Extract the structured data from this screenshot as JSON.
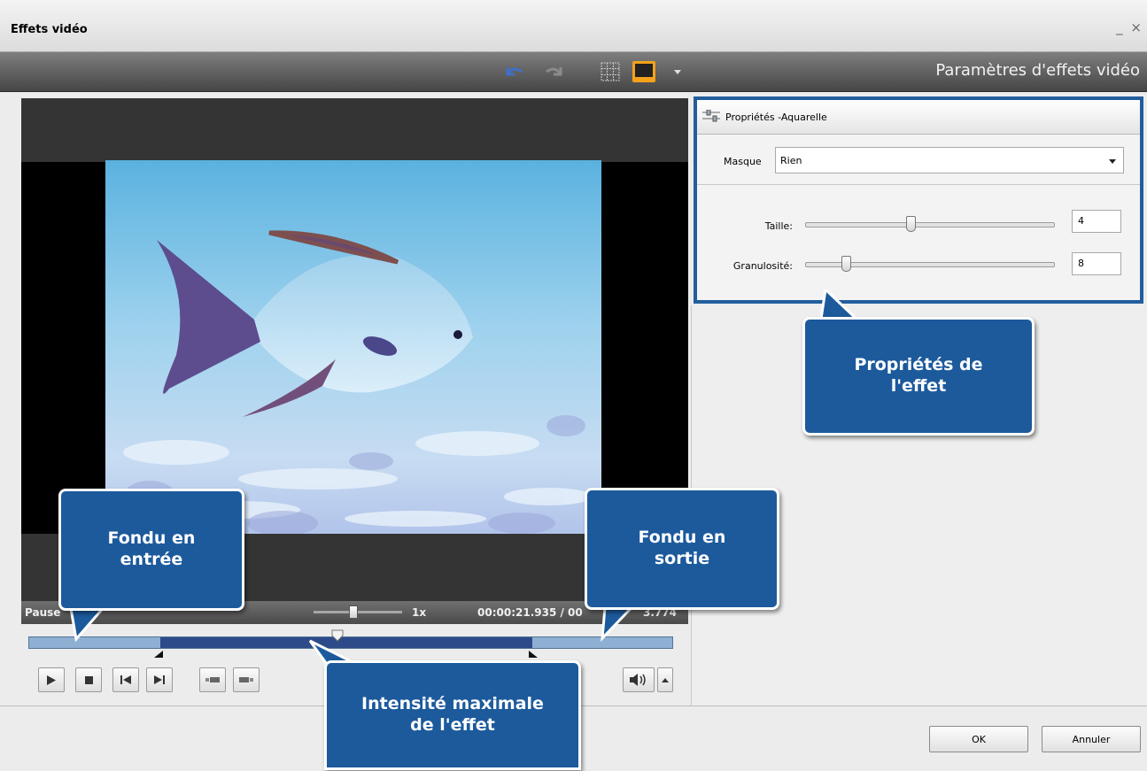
{
  "window": {
    "title": "Effets vidéo",
    "controls": "_ ×"
  },
  "toolbar": {
    "title": "Paramètres d'effets vidéo",
    "icons": [
      "undo-icon",
      "redo-icon",
      "grid-icon",
      "monitor-icon",
      "dropdown-arrow-icon"
    ]
  },
  "player": {
    "status": "Pause",
    "speed": "1x",
    "time": "00:00:21.935 / 00",
    "time_tail": "3.774",
    "speed_level": 0.45,
    "playhead_position": 0.48
  },
  "properties": {
    "title": "Propriétés -Aquarelle",
    "mask_label": "Masque",
    "mask_value": "Rien",
    "size_label": "Taille:",
    "size_value": "4",
    "grain_label": "Granulosité:",
    "grain_value": "8"
  },
  "buttons": {
    "ok": "OK",
    "cancel": "Annuler"
  },
  "callouts": {
    "effect_properties": "Propriétés de\nl'effet",
    "fade_in": "Fondu en\nentrée",
    "fade_out": "Fondu en\nsortie",
    "max_intensity": "Intensité maximale\nde l'effet"
  },
  "colors": {
    "callout": "#1c5a9c",
    "timeline_light": "#8fb0d3",
    "timeline_dark": "#2d4a89",
    "highlight_border": "#215e9e"
  }
}
